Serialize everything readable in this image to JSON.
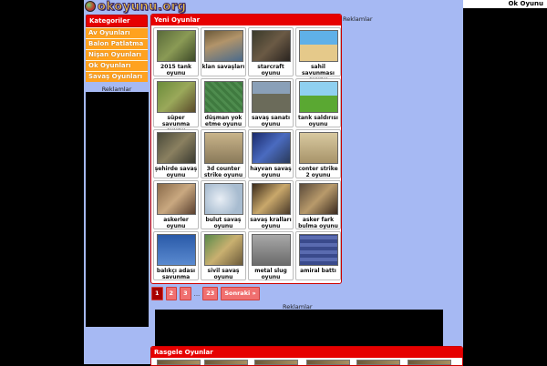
{
  "site": {
    "logo_text": "okoyunu.org",
    "top_right": "Ok Oyunu"
  },
  "sidebar": {
    "title": "Kategoriler",
    "items": [
      "Av Oyunları",
      "Balon Patlatma",
      "Nişan Oyunları",
      "Ok Oyunları",
      "Savaş Oyunları"
    ],
    "ad_label": "Reklamlar"
  },
  "main": {
    "title": "Yeni Oyunlar",
    "games": [
      "2015 tank oyunu",
      "klan savaşları",
      "starcraft oyunu",
      "sahil savunması oyunu",
      "süper savunma oyunu",
      "düşman yok etme oyunu",
      "savaş sanatı oyunu",
      "tank saldırısı oyunu",
      "şehirde savaş oyunu",
      "3d counter strike oyunu",
      "hayvan savaş oyunu",
      "conter strike 2 oyunu",
      "askerler oyunu",
      "bulut savaş oyunu",
      "savaş kralları oyunu",
      "asker fark bulma oyunu",
      "balıkçı adası savunma",
      "sivil savaş oyunu",
      "metal slug oyunu",
      "amiral battı"
    ]
  },
  "pager": {
    "pages": [
      "1",
      "2",
      "3"
    ],
    "dots": "...",
    "last": "23",
    "next": "Sonraki »",
    "current": "1"
  },
  "ads": {
    "right_label": "Reklamlar",
    "bottom_label": "Reklamlar"
  },
  "random": {
    "title": "Rasgele Oyunlar"
  },
  "colors": {
    "accent_red": "#e60000",
    "category_orange": "#ffa21f",
    "background_blue": "#a6b9f3"
  }
}
